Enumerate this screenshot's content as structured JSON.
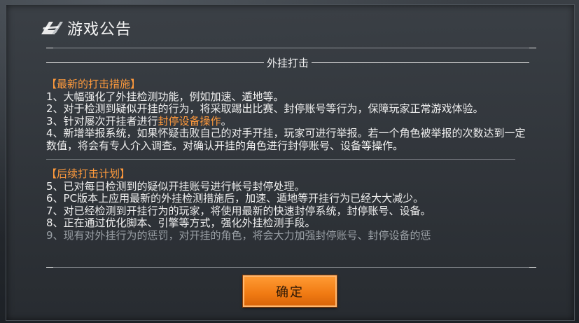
{
  "header": {
    "title": "游戏公告"
  },
  "section": {
    "title": "外挂打击"
  },
  "block1": {
    "heading": "【最新的打击措施】",
    "items": [
      "1、大幅强化了外挂检测功能，例如加速、遁地等。",
      "2、对于检测到疑似开挂的行为，将采取踢出比赛、封停账号等行为，保障玩家正常游戏体验。",
      "3、针对屡次开挂者进行",
      "封停设备操作",
      "。",
      "4、新增举报系统，如果怀疑击败自己的对手开挂，玩家可进行举报。若一个角色被举报的次数达到一定数值，将会有专人介入调查。对确认开挂的角色进行封停账号、设备等操作。"
    ]
  },
  "block2": {
    "heading": "【后续打击计划】",
    "items": [
      "5、已对每日检测到的疑似开挂账号进行帐号封停处理。",
      "6、PC版本上应用最新的外挂检测措施后，加速、遁地等开挂行为已经大大减少。",
      "7、对已经检测到开挂行为的玩家，将使用最新的快速封停系统，封停账号、设备。",
      "8、正在通过优化脚本、引擎等方式，强化外挂检测手段。",
      "9、现有对外挂行为的惩罚，对开挂的角色，将会大力加强封停账号、封停设备的惩"
    ]
  },
  "footer": {
    "confirm_label": "确定"
  },
  "colors": {
    "accent": "#ff9a3c",
    "button": "#f07a12"
  },
  "icons": {
    "logo": "game-logo-icon"
  }
}
